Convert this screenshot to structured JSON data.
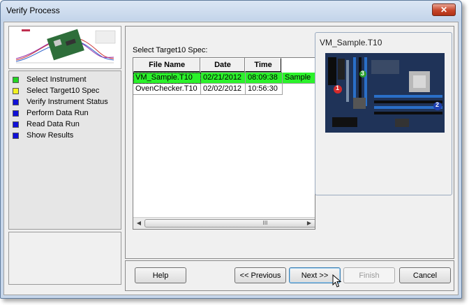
{
  "window": {
    "title": "Verify Process",
    "close_symbol": "✕"
  },
  "steps": [
    {
      "label": "Select Instrument",
      "color": "#22d422"
    },
    {
      "label": "Select Target10 Spec",
      "color": "#f2f21e"
    },
    {
      "label": "Verify Instrument Status",
      "color": "#1010d8"
    },
    {
      "label": "Perform Data Run",
      "color": "#1010d8"
    },
    {
      "label": "Read Data Run",
      "color": "#1010d8"
    },
    {
      "label": "Show Results",
      "color": "#1010d8"
    }
  ],
  "spec_label": "Select Target10 Spec:",
  "table": {
    "columns": [
      "File Name",
      "Date",
      "Time",
      ""
    ],
    "rows": [
      {
        "file": "VM_Sample.T10",
        "date": "02/21/2012",
        "time": "08:09:38",
        "desc": "Sample",
        "selected": true
      },
      {
        "file": "OvenChecker.T10",
        "date": "02/02/2012",
        "time": "10:56:30",
        "desc": "",
        "selected": false
      }
    ],
    "scroll_grip": "III"
  },
  "preview": {
    "title": "VM_Sample.T10",
    "markers": [
      "1",
      "2",
      "3"
    ]
  },
  "buttons": {
    "help": "Help",
    "previous": "<< Previous",
    "next": "Next >>",
    "finish": "Finish",
    "cancel": "Cancel"
  },
  "colors": {
    "selection": "#2bf22b",
    "accent": "#3c7fb1"
  }
}
